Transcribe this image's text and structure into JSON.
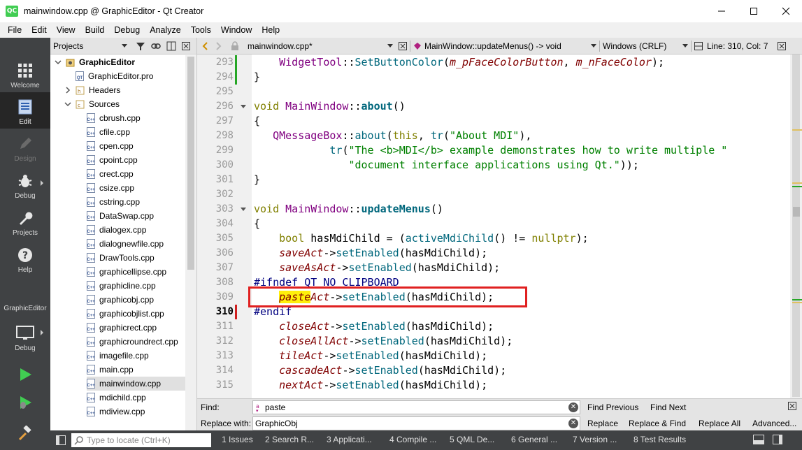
{
  "window": {
    "title": "mainwindow.cpp @ GraphicEditor - Qt Creator",
    "logo": "QC",
    "minimize_icon": "minimize-icon",
    "maximize_icon": "maximize-icon",
    "close_icon": "close-icon"
  },
  "menu": [
    "File",
    "Edit",
    "View",
    "Build",
    "Debug",
    "Analyze",
    "Tools",
    "Window",
    "Help"
  ],
  "modes": [
    {
      "label": "Welcome",
      "icon": "grid-icon"
    },
    {
      "label": "Edit",
      "icon": "document-icon"
    },
    {
      "label": "Design",
      "icon": "pencil-icon"
    },
    {
      "label": "Debug",
      "icon": "bug-icon"
    },
    {
      "label": "Projects",
      "icon": "wrench-icon"
    },
    {
      "label": "Help",
      "icon": "help-icon"
    }
  ],
  "kit": {
    "name": "GraphicEditor",
    "build_label": "Debug"
  },
  "projects": {
    "header": "Projects",
    "tree": [
      {
        "label": "GraphicEditor",
        "level": 0,
        "type": "project",
        "expanded": true
      },
      {
        "label": "GraphicEditor.pro",
        "level": 1,
        "type": "pro"
      },
      {
        "label": "Headers",
        "level": 1,
        "type": "folder",
        "expanded": false
      },
      {
        "label": "Sources",
        "level": 1,
        "type": "folder",
        "expanded": true
      },
      {
        "label": "cbrush.cpp",
        "level": 2,
        "type": "cpp"
      },
      {
        "label": "cfile.cpp",
        "level": 2,
        "type": "cpp"
      },
      {
        "label": "cpen.cpp",
        "level": 2,
        "type": "cpp"
      },
      {
        "label": "cpoint.cpp",
        "level": 2,
        "type": "cpp"
      },
      {
        "label": "crect.cpp",
        "level": 2,
        "type": "cpp"
      },
      {
        "label": "csize.cpp",
        "level": 2,
        "type": "cpp"
      },
      {
        "label": "cstring.cpp",
        "level": 2,
        "type": "cpp"
      },
      {
        "label": "DataSwap.cpp",
        "level": 2,
        "type": "cpp"
      },
      {
        "label": "dialogex.cpp",
        "level": 2,
        "type": "cpp"
      },
      {
        "label": "dialognewfile.cpp",
        "level": 2,
        "type": "cpp"
      },
      {
        "label": "DrawTools.cpp",
        "level": 2,
        "type": "cpp"
      },
      {
        "label": "graphicellipse.cpp",
        "level": 2,
        "type": "cpp"
      },
      {
        "label": "graphicline.cpp",
        "level": 2,
        "type": "cpp"
      },
      {
        "label": "graphicobj.cpp",
        "level": 2,
        "type": "cpp"
      },
      {
        "label": "graphicobjlist.cpp",
        "level": 2,
        "type": "cpp"
      },
      {
        "label": "graphicrect.cpp",
        "level": 2,
        "type": "cpp"
      },
      {
        "label": "graphicroundrect.cpp",
        "level": 2,
        "type": "cpp"
      },
      {
        "label": "imagefile.cpp",
        "level": 2,
        "type": "cpp"
      },
      {
        "label": "main.cpp",
        "level": 2,
        "type": "cpp"
      },
      {
        "label": "mainwindow.cpp",
        "level": 2,
        "type": "cpp",
        "selected": true
      },
      {
        "label": "mdichild.cpp",
        "level": 2,
        "type": "cpp"
      },
      {
        "label": "mdiview.cpp",
        "level": 2,
        "type": "cpp"
      }
    ]
  },
  "editor": {
    "file_tab": "mainwindow.cpp*",
    "symbol": "MainWindow::updateMenus() -> void",
    "line_ending": "Windows (CRLF)",
    "position": "Line: 310, Col: 7",
    "current_line": 310,
    "lines": [
      {
        "n": 293,
        "segs": [
          [
            "    ",
            ""
          ],
          [
            "WidgetTool",
            "t"
          ],
          [
            "::",
            ""
          ],
          [
            "SetButtonColor",
            "f"
          ],
          [
            "(",
            ""
          ],
          [
            "m_pFaceColorButton",
            "m"
          ],
          [
            ", ",
            ""
          ],
          [
            "m_nFaceColor",
            "m"
          ],
          [
            ");",
            ""
          ]
        ]
      },
      {
        "n": 294,
        "segs": [
          [
            "}",
            ""
          ]
        ]
      },
      {
        "n": 295,
        "segs": []
      },
      {
        "n": 296,
        "segs": [
          [
            "void",
            "k"
          ],
          [
            " ",
            ""
          ],
          [
            "MainWindow",
            "t"
          ],
          [
            "::",
            ""
          ],
          [
            "about",
            "fb"
          ],
          [
            "()",
            ""
          ]
        ]
      },
      {
        "n": 297,
        "segs": [
          [
            "{",
            ""
          ]
        ]
      },
      {
        "n": 298,
        "segs": [
          [
            "   ",
            ""
          ],
          [
            "QMessageBox",
            "t"
          ],
          [
            "::",
            ""
          ],
          [
            "about",
            "f"
          ],
          [
            "(",
            ""
          ],
          [
            "this",
            "k"
          ],
          [
            ", ",
            ""
          ],
          [
            "tr",
            "f"
          ],
          [
            "(",
            ""
          ],
          [
            "\"About MDI\"",
            "s"
          ],
          [
            "),",
            ""
          ]
        ]
      },
      {
        "n": 299,
        "segs": [
          [
            "            ",
            ""
          ],
          [
            "tr",
            "f"
          ],
          [
            "(",
            ""
          ],
          [
            "\"The <b>MDI</b> example demonstrates how to write multiple \"",
            "s"
          ]
        ]
      },
      {
        "n": 300,
        "segs": [
          [
            "               ",
            ""
          ],
          [
            "\"document interface applications using Qt.\"",
            "s"
          ],
          [
            "));",
            ""
          ]
        ]
      },
      {
        "n": 301,
        "segs": [
          [
            "}",
            ""
          ]
        ]
      },
      {
        "n": 302,
        "segs": []
      },
      {
        "n": 303,
        "segs": [
          [
            "void",
            "k"
          ],
          [
            " ",
            ""
          ],
          [
            "MainWindow",
            "t"
          ],
          [
            "::",
            ""
          ],
          [
            "updateMenus",
            "fb"
          ],
          [
            "()",
            ""
          ]
        ]
      },
      {
        "n": 304,
        "segs": [
          [
            "{",
            ""
          ]
        ]
      },
      {
        "n": 305,
        "segs": [
          [
            "    ",
            ""
          ],
          [
            "bool",
            "k"
          ],
          [
            " hasMdiChild = (",
            ""
          ],
          [
            "activeMdiChild",
            "f"
          ],
          [
            "() != ",
            ""
          ],
          [
            "nullptr",
            "k"
          ],
          [
            ");",
            ""
          ]
        ]
      },
      {
        "n": 306,
        "segs": [
          [
            "    ",
            ""
          ],
          [
            "saveAct",
            "m"
          ],
          [
            "->",
            ""
          ],
          [
            "setEnabled",
            "f"
          ],
          [
            "(hasMdiChild);",
            ""
          ]
        ]
      },
      {
        "n": 307,
        "segs": [
          [
            "    ",
            ""
          ],
          [
            "saveAsAct",
            "m"
          ],
          [
            "->",
            ""
          ],
          [
            "setEnabled",
            "f"
          ],
          [
            "(hasMdiChild);",
            ""
          ]
        ]
      },
      {
        "n": 308,
        "segs": [
          [
            "#ifndef QT_NO_CLIPBOARD",
            "p"
          ]
        ]
      },
      {
        "n": 309,
        "segs": [
          [
            "    ",
            ""
          ],
          [
            "paste",
            "mh"
          ],
          [
            "Act",
            "m"
          ],
          [
            "->",
            ""
          ],
          [
            "setEnabled",
            "f"
          ],
          [
            "(hasMdiChild);",
            ""
          ]
        ]
      },
      {
        "n": 310,
        "segs": [
          [
            "#endif",
            "p"
          ]
        ]
      },
      {
        "n": 311,
        "segs": [
          [
            "    ",
            ""
          ],
          [
            "closeAct",
            "m"
          ],
          [
            "->",
            ""
          ],
          [
            "setEnabled",
            "f"
          ],
          [
            "(hasMdiChild);",
            ""
          ]
        ]
      },
      {
        "n": 312,
        "segs": [
          [
            "    ",
            ""
          ],
          [
            "closeAllAct",
            "m"
          ],
          [
            "->",
            ""
          ],
          [
            "setEnabled",
            "f"
          ],
          [
            "(hasMdiChild);",
            ""
          ]
        ]
      },
      {
        "n": 313,
        "segs": [
          [
            "    ",
            ""
          ],
          [
            "tileAct",
            "m"
          ],
          [
            "->",
            ""
          ],
          [
            "setEnabled",
            "f"
          ],
          [
            "(hasMdiChild);",
            ""
          ]
        ]
      },
      {
        "n": 314,
        "segs": [
          [
            "    ",
            ""
          ],
          [
            "cascadeAct",
            "m"
          ],
          [
            "->",
            ""
          ],
          [
            "setEnabled",
            "f"
          ],
          [
            "(hasMdiChild);",
            ""
          ]
        ]
      },
      {
        "n": 315,
        "segs": [
          [
            "    ",
            ""
          ],
          [
            "nextAct",
            "m"
          ],
          [
            "->",
            ""
          ],
          [
            "setEnabled",
            "f"
          ],
          [
            "(hasMdiChild);",
            ""
          ]
        ]
      }
    ]
  },
  "find": {
    "find_label": "Find:",
    "replace_label": "Replace with:",
    "find_value": "paste",
    "replace_value": "GraphicObj",
    "find_previous": "Find Previous",
    "find_next": "Find Next",
    "replace": "Replace",
    "replace_find": "Replace & Find",
    "replace_all": "Replace All",
    "advanced": "Advanced..."
  },
  "status": {
    "locate_placeholder": "Type to locate (Ctrl+K)",
    "tabs": [
      "1 Issues",
      "2 Search R...",
      "3 Applicati...",
      "4 Compile ...",
      "5 QML De...",
      "6 General ...",
      "7 Version ...",
      "8 Test Results"
    ]
  },
  "colors": {
    "modebar": "#404244",
    "highlight": "#ffef0b",
    "box": "#e02020",
    "run_green": "#41cd52"
  }
}
